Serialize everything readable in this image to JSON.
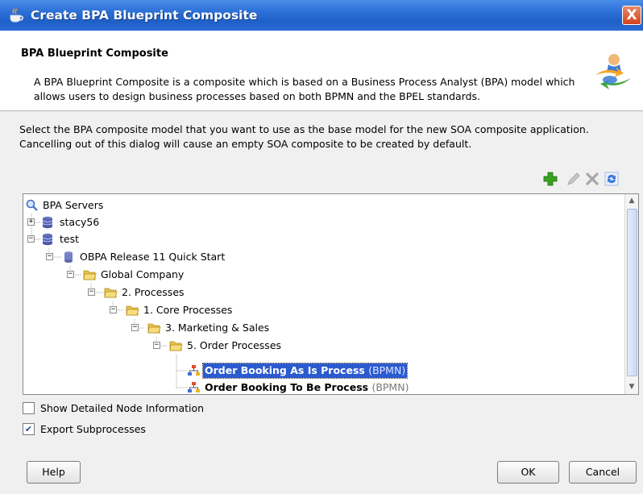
{
  "window": {
    "title": "Create BPA Blueprint Composite",
    "close_label": "X"
  },
  "header": {
    "title": "BPA Blueprint Composite",
    "description": "A BPA Blueprint Composite is a composite which is based on a Business Process Analyst (BPA) model which allows users to design business processes based on both BPMN and the BPEL standards."
  },
  "instructions": "Select the BPA composite model that you want to use as the base model for the new SOA composite application. Cancelling out of this dialog will cause an empty SOA composite to be created by default.",
  "toolbar": {
    "icons": [
      "add-icon",
      "edit-icon",
      "delete-icon",
      "refresh-icon"
    ]
  },
  "tree": {
    "nodes": [
      {
        "label": "BPA Servers",
        "icon": "search-icon"
      },
      {
        "label": "stacy56",
        "icon": "database-icon",
        "expanded": false
      },
      {
        "label": "test",
        "icon": "database-icon",
        "expanded": true
      },
      {
        "label": "OBPA Release 11 Quick Start",
        "icon": "database-icon",
        "expanded": true
      },
      {
        "label": "Global Company",
        "icon": "folder-icon",
        "expanded": true
      },
      {
        "label": "2. Processes",
        "icon": "folder-icon",
        "expanded": true
      },
      {
        "label": "1. Core Processes",
        "icon": "folder-icon",
        "expanded": true
      },
      {
        "label": "3. Marketing & Sales",
        "icon": "folder-icon",
        "expanded": true
      },
      {
        "label": "5. Order Processes",
        "icon": "folder-icon",
        "expanded": true
      },
      {
        "label": "Order Booking As Is Process",
        "suffix": "(BPMN)",
        "icon": "process-icon",
        "selected": true
      },
      {
        "label": "Order Booking To Be Process",
        "suffix": "(BPMN)",
        "icon": "process-icon",
        "selected": false
      }
    ]
  },
  "options": {
    "show_detailed": {
      "label": "Show Detailed Node Information",
      "checked": false
    },
    "export_subprocesses": {
      "label": "Export Subprocesses",
      "checked": true
    }
  },
  "buttons": {
    "help": "Help",
    "ok": "OK",
    "cancel": "Cancel"
  },
  "colors": {
    "titlebar": "#2b6fd6",
    "selection": "#2c5bd0",
    "folder": "#f2d46c",
    "add_icon": "#37a31f"
  }
}
